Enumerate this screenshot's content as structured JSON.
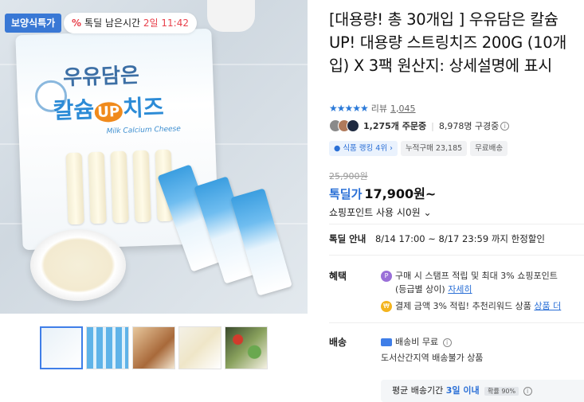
{
  "gallery": {
    "badge": "보양식특가",
    "timer_icon": "%",
    "timer_label": "톡딜 남은시간",
    "timer_value": "2일 11:42",
    "package_line1": "우유담은",
    "package_line2_left": "칼슘",
    "package_up": "UP",
    "package_line2_right": "치즈",
    "package_subtitle": "Milk Calcium Cheese",
    "thumbnails": [
      "thumb-1",
      "thumb-2",
      "thumb-3",
      "thumb-4",
      "thumb-5"
    ],
    "active_thumbnail": 0
  },
  "product": {
    "title": "[대용량! 총 30개입 ] 우유담은 칼슘 UP! 대용량 스트링치즈 200G (10개입) X 3팩 원산지: 상세설명에 표시",
    "review_label": "리뷰",
    "review_count": "1,045",
    "stars": "★★★★★",
    "buyers": "1,275개 주문중",
    "subscribers": "8,978명 구경중",
    "tags": [
      "식품 랭킹 4위",
      "누적구매 23,185",
      "무료배송"
    ],
    "original_price": "25,900원",
    "price_label": "톡딜가",
    "price": "17,900원~",
    "points_text": "쇼핑포인트 사용 시0원",
    "deal_label": "톡딜 안내",
    "deal_text": "8/14 17:00 ~ 8/17 23:59 까지 한정할인"
  },
  "benefits": {
    "label": "혜택",
    "item1_icon": "P",
    "item1": "구매 시 스탬프 적립 및 최대 3% 쇼핑포인트",
    "item1_sub": "(등급별 상이)",
    "item1_link": "자세히",
    "item2_icon": "₩",
    "item2": "결제 금액 3% 적립! 추천리워드 상품",
    "item2_link": "상품 더"
  },
  "shipping": {
    "label": "배송",
    "fee": "배송비 무료",
    "note": "도서산간지역 배송불가 상품",
    "avg_label": "평균 배송기간",
    "avg_days": "3일 이내",
    "avg_rate": "확률 90%"
  },
  "colors": {
    "accent": "#2a6fd6",
    "badge": "#3978d5",
    "timer": "#e8414c"
  }
}
